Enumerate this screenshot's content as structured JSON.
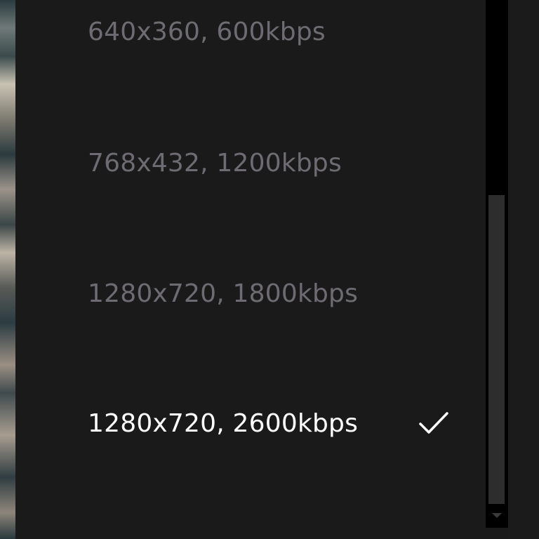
{
  "quality_menu": {
    "items": [
      {
        "label": "640x360, 600kbps",
        "selected": false
      },
      {
        "label": "768x432, 1200kbps",
        "selected": false
      },
      {
        "label": "1280x720, 1800kbps",
        "selected": false
      },
      {
        "label": "1280x720, 2600kbps",
        "selected": true
      }
    ],
    "selected_icon": "checkmark-icon"
  },
  "scrollbar": {
    "arrow_icon": "scroll-down-arrow-icon",
    "position": 0.58
  },
  "colors": {
    "background": "#1b1a1a",
    "unselected_text": "#6e6c72",
    "selected_text": "#ffffff",
    "scrollbar_track": "#000000",
    "scrollbar_thumb": "#2e2d2d"
  }
}
